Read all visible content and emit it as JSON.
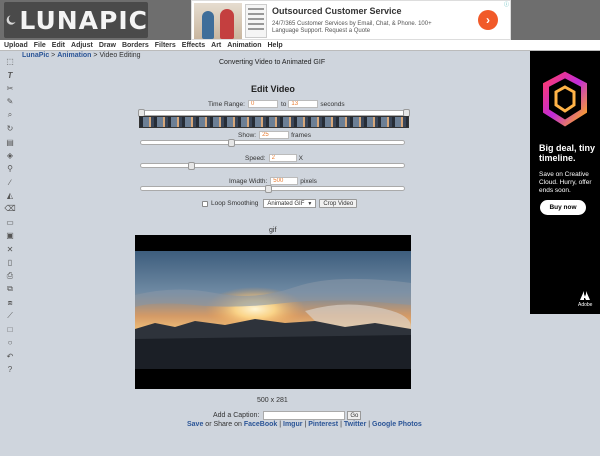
{
  "header": {
    "logo_text": "LUNAPIC"
  },
  "top_ad": {
    "title": "Outsourced Customer Service",
    "subtitle": "24/7/365 Customer Services by Email, Chat, & Phone. 100+ Language Support. Request a Quote"
  },
  "menu": [
    "Upload",
    "File",
    "Edit",
    "Adjust",
    "Draw",
    "Borders",
    "Filters",
    "Effects",
    "Art",
    "Animation",
    "Help"
  ],
  "breadcrumb": {
    "home": "LunaPic",
    "sep1": " > ",
    "section": "Animation",
    "sep2": " > ",
    "current": "Video Editing"
  },
  "page": {
    "subtitle": "Converting Video to Animated GIF",
    "title": "Edit Video"
  },
  "controls": {
    "time_range_label": "Time Range:",
    "time_from": "0",
    "time_to_label": "to",
    "time_to": "13",
    "time_unit": "seconds",
    "show_label": "Show:",
    "show_value": "25",
    "show_unit": "frames",
    "speed_label": "Speed:",
    "speed_value": "2",
    "speed_unit": "X",
    "width_label": "Image Width:",
    "width_value": "500",
    "width_unit": "pixels",
    "loop_label": "Loop Smoothing",
    "format_value": "Animated GIF",
    "crop_label": "Crop Video"
  },
  "sliders": {
    "show_level": 0.33,
    "speed_level": 0.18,
    "width_level": 0.47
  },
  "preview": {
    "label": "gif",
    "dimensions": "500 x 281"
  },
  "caption": {
    "label": "Add a Caption:",
    "go_label": "Go"
  },
  "share": {
    "save": "Save",
    "or_share": " or Share on ",
    "facebook": "FaceBook",
    "sep1": " | ",
    "imgur": "Imgur",
    "sep2": " | ",
    "pinterest": "Pinterest",
    "sep3": " | ",
    "twitter": "Twitter",
    "sep4": " | ",
    "google": "Google Photos"
  },
  "right_ad": {
    "title": "Big deal, tiny timeline.",
    "body": "Save on Creative Cloud. Hurry, offer ends soon.",
    "button": "Buy now",
    "brand": "Adobe"
  },
  "tools": [
    "select-icon",
    "text-icon",
    "scissors-icon",
    "pencil-icon",
    "zoom-icon",
    "rotate-icon",
    "layers-icon",
    "fill-icon",
    "eyedropper-icon",
    "brush-icon",
    "bucket-icon",
    "eraser-icon",
    "open-icon",
    "save-icon",
    "close-icon",
    "new-icon",
    "print-icon",
    "copy-icon",
    "paste-icon",
    "line-icon",
    "rectangle-icon",
    "circle-icon",
    "undo-icon",
    "help-icon"
  ]
}
